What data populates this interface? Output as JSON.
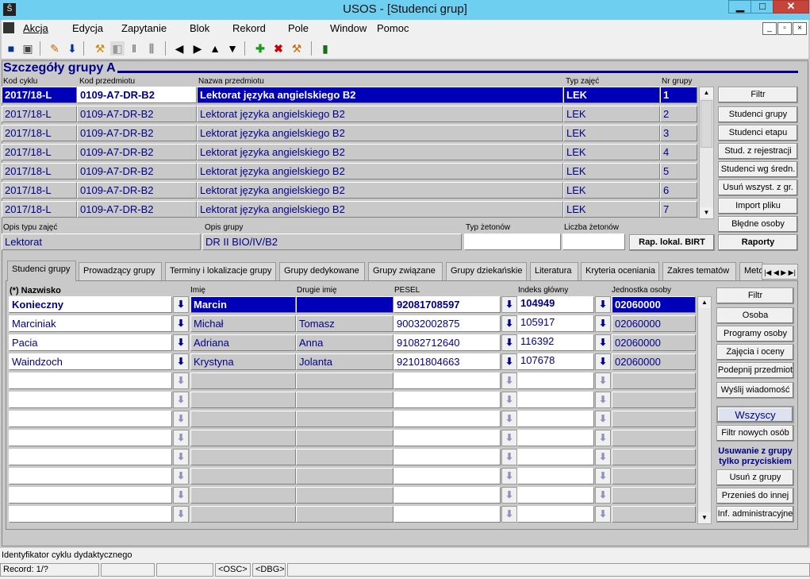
{
  "window": {
    "title": "USOS - [Studenci grup]",
    "minimize": "▁",
    "maximize": "□",
    "close": "✕"
  },
  "menu": [
    "Akcja",
    "Edycja",
    "Zapytanie",
    "Blok",
    "Rekord",
    "Pole",
    "Window",
    "Pomoc"
  ],
  "mdi": {
    "minimize": "_",
    "restore": "▫",
    "close": "×"
  },
  "header": {
    "title": "Szczegóły grupy  A"
  },
  "groups": {
    "columns": {
      "kod_cyklu": "Kod cyklu",
      "kod_przedmiotu": "Kod przedmiotu",
      "nazwa": "Nazwa przedmiotu",
      "typ": "Typ zajęć",
      "nr": "Nr grupy"
    },
    "rows": [
      {
        "kod_cyklu": "2017/18-L",
        "kod_przedmiotu": "0109-A7-DR-B2",
        "nazwa": "Lektorat języka angielskiego B2",
        "typ": "LEK",
        "nr": "1"
      },
      {
        "kod_cyklu": "2017/18-L",
        "kod_przedmiotu": "0109-A7-DR-B2",
        "nazwa": "Lektorat języka angielskiego B2",
        "typ": "LEK",
        "nr": "2"
      },
      {
        "kod_cyklu": "2017/18-L",
        "kod_przedmiotu": "0109-A7-DR-B2",
        "nazwa": "Lektorat języka angielskiego B2",
        "typ": "LEK",
        "nr": "3"
      },
      {
        "kod_cyklu": "2017/18-L",
        "kod_przedmiotu": "0109-A7-DR-B2",
        "nazwa": "Lektorat języka angielskiego B2",
        "typ": "LEK",
        "nr": "4"
      },
      {
        "kod_cyklu": "2017/18-L",
        "kod_przedmiotu": "0109-A7-DR-B2",
        "nazwa": "Lektorat języka angielskiego B2",
        "typ": "LEK",
        "nr": "5"
      },
      {
        "kod_cyklu": "2017/18-L",
        "kod_przedmiotu": "0109-A7-DR-B2",
        "nazwa": "Lektorat języka angielskiego B2",
        "typ": "LEK",
        "nr": "6"
      },
      {
        "kod_cyklu": "2017/18-L",
        "kod_przedmiotu": "0109-A7-DR-B2",
        "nazwa": "Lektorat języka angielskiego B2",
        "typ": "LEK",
        "nr": "7"
      }
    ],
    "buttons": [
      "Filtr",
      "Studenci grupy",
      "Studenci etapu",
      "Stud. z rejestracji",
      "Studenci wg średn.",
      "Usuń wszyst. z gr.",
      "Import pliku",
      "Błędne osoby"
    ]
  },
  "details": {
    "opis_typu_label": "Opis typu zajęć",
    "opis_typu": "Lektorat",
    "opis_grupy_label": "Opis grupy",
    "opis_grupy": "DR II BIO/IV/B2",
    "typ_zetonow_label": "Typ żetonów",
    "typ_zetonow": "",
    "liczba_zetonow_label": "Liczba żetonów",
    "liczba_zetonow": "",
    "rap_button": "Rap. lokal. BIRT",
    "raporty_button": "Raporty"
  },
  "tabs": [
    "Studenci grupy",
    "Prowadzący grupy",
    "Terminy i lokalizacje grupy",
    "Grupy dedykowane",
    "Grupy związane",
    "Grupy dziekańskie",
    "Literatura",
    "Kryteria oceniania",
    "Zakres tematów",
    "Meto"
  ],
  "students": {
    "columns": {
      "nazwisko": "(*) Nazwisko",
      "imie": "Imię",
      "drugie": "Drugie imię",
      "pesel": "PESEL",
      "indeks": "Indeks główny",
      "jednostka": "Jednostka osoby"
    },
    "rows": [
      {
        "nazwisko": "Konieczny",
        "imie": "Marcin",
        "drugie": "",
        "pesel": "92081708597",
        "indeks": "104949",
        "jednostka": "02060000"
      },
      {
        "nazwisko": "Marciniak",
        "imie": "Michał",
        "drugie": "Tomasz",
        "pesel": "90032002875",
        "indeks": "105917",
        "jednostka": "02060000"
      },
      {
        "nazwisko": "Pacia",
        "imie": "Adriana",
        "drugie": "Anna",
        "pesel": "91082712640",
        "indeks": "116392",
        "jednostka": "02060000"
      },
      {
        "nazwisko": "Waindzoch",
        "imie": "Krystyna",
        "drugie": "Jolanta",
        "pesel": "92101804663",
        "indeks": "107678",
        "jednostka": "02060000"
      }
    ],
    "buttons": [
      "Filtr",
      "Osoba",
      "Programy osoby",
      "Zajęcia i oceny",
      "Podepnij przedmiot",
      "Wyślij wiadomość"
    ],
    "wszyscy": "Wszyscy",
    "filtr_nowych": "Filtr nowych osób",
    "usuwanie_note_1": "Usuwanie z grupy",
    "usuwanie_note_2": "tylko przyciskiem",
    "buttons2": [
      "Usuń z grupy",
      "Przenieś do innej",
      "Inf. administracyjne"
    ]
  },
  "status": {
    "hint": "Identyfikator cyklu dydaktycznego",
    "record": "Record: 1/?",
    "osc": "<OSC>",
    "dbg": "<DBG>"
  }
}
